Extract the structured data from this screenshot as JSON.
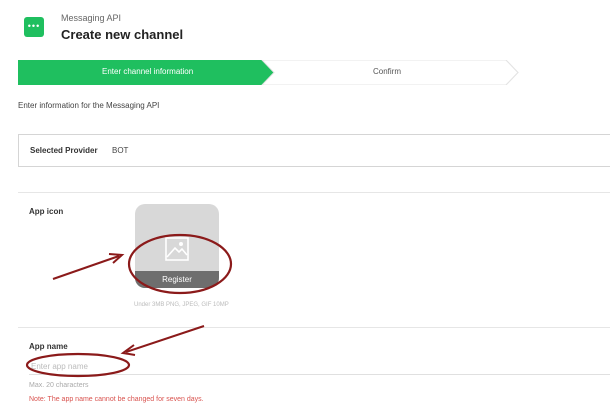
{
  "header": {
    "icon": "chat-bubble-icon",
    "subtitle": "Messaging API",
    "title": "Create new channel"
  },
  "stepper": {
    "steps": [
      {
        "label": "Enter channel information",
        "active": true
      },
      {
        "label": "Confirm",
        "active": false
      }
    ],
    "active_color": "#1fbf5f"
  },
  "intro_text": "Enter information for the Messaging API",
  "provider": {
    "label": "Selected Provider",
    "value": "BOT"
  },
  "app_icon": {
    "label": "App icon",
    "register_label": "Register",
    "hint": "Under 3MB PNG, JPEG, GIF 10MP"
  },
  "app_name": {
    "label": "App name",
    "placeholder": "Enter app name",
    "value": "",
    "max_chars": "Max. 20 characters",
    "note": "Note: The app name cannot be changed for seven days."
  },
  "colors": {
    "annotation": "#8b1a1a",
    "note": "#d9534f"
  }
}
